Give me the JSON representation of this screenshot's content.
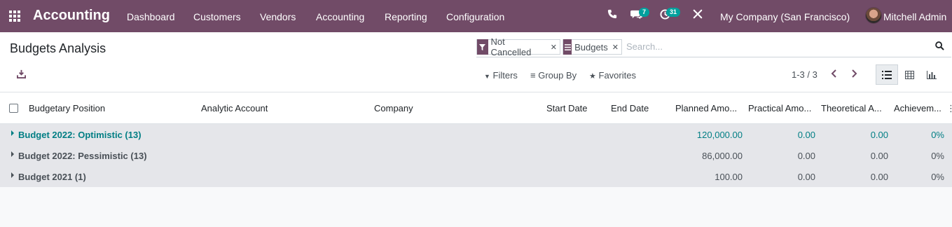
{
  "navbar": {
    "app_name": "Accounting",
    "menu": [
      "Dashboard",
      "Customers",
      "Vendors",
      "Accounting",
      "Reporting",
      "Configuration"
    ],
    "messages_count": "7",
    "activities_count": "31",
    "company": "My Company (San Francisco)",
    "user": "Mitchell Admin",
    "accent": "#714b67",
    "badge_color": "#00a09d"
  },
  "control_panel": {
    "title": "Budgets Analysis",
    "facets": [
      {
        "icon": "filter-icon",
        "label": "Not Cancelled"
      },
      {
        "icon": "group-by-icon",
        "label": "Budgets"
      }
    ],
    "search_placeholder": "Search...",
    "filters_label": "Filters",
    "group_by_label": "Group By",
    "favorites_label": "Favorites",
    "pager": "1-3 / 3",
    "active_view": "list"
  },
  "table": {
    "columns": [
      "Budgetary Position",
      "Analytic Account",
      "Company",
      "Start Date",
      "End Date",
      "Planned Amo...",
      "Practical Amo...",
      "Theoretical A...",
      "Achievem..."
    ],
    "groups": [
      {
        "name": "Budget 2022: Optimistic (13)",
        "planned": "120,000.00",
        "practical": "0.00",
        "theoretical": "0.00",
        "achievement": "0%"
      },
      {
        "name": "Budget 2022: Pessimistic (13)",
        "planned": "86,000.00",
        "practical": "0.00",
        "theoretical": "0.00",
        "achievement": "0%"
      },
      {
        "name": "Budget 2021 (1)",
        "planned": "100.00",
        "practical": "0.00",
        "theoretical": "0.00",
        "achievement": "0%"
      }
    ]
  }
}
